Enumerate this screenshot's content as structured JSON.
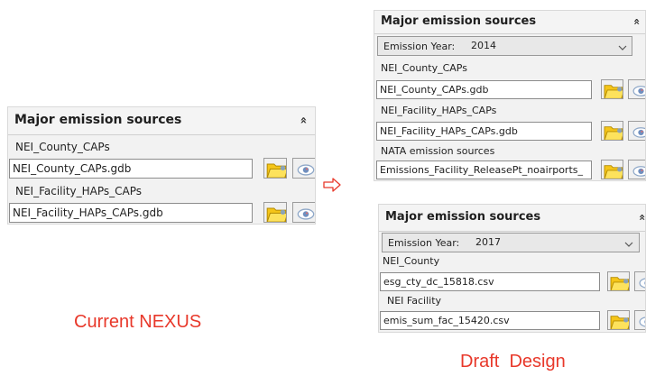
{
  "current": {
    "title": "Major emission sources",
    "collapse_glyph": "«",
    "sources": [
      {
        "label": "NEI_County_CAPs",
        "file": "NEI_County_CAPs.gdb"
      },
      {
        "label": "NEI_Facility_HAPs_CAPs",
        "file": "NEI_Facility_HAPs_CAPs.gdb"
      }
    ],
    "caption": "Current NEXUS"
  },
  "draft_top": {
    "title": "Major emission sources",
    "collapse_glyph": "«",
    "emission_year_label": "Emission Year:",
    "emission_year_value": "2014",
    "sources": [
      {
        "label": "NEI_County_CAPs",
        "file": "NEI_County_CAPs.gdb"
      },
      {
        "label": "NEI_Facility_HAPs_CAPs",
        "file": "NEI_Facility_HAPs_CAPs.gdb"
      },
      {
        "label": "NATA emission sources",
        "file": "Emissions_Facility_ReleasePt_noairports_"
      }
    ]
  },
  "draft_bottom": {
    "title": "Major emission sources",
    "collapse_glyph": "«",
    "emission_year_label": "Emission Year:",
    "emission_year_value": "2017",
    "sources": [
      {
        "label": "NEI_County",
        "file": "esg_cty_dc_15818.csv"
      },
      {
        "label": "NEI Facility",
        "file": "emis_sum_fac_15420.csv"
      }
    ]
  },
  "draft_caption": "Draft  Design",
  "icons": {
    "folder": "folder-open-icon",
    "view": "eye-icon",
    "arrow": "right-arrow-icon",
    "dropdown": "chevron-down-icon",
    "collapse": "double-chevron-up-icon"
  },
  "colors": {
    "caption": "#e8382a",
    "folder": "#f5c518",
    "panel_bg": "#f2f2f2"
  }
}
